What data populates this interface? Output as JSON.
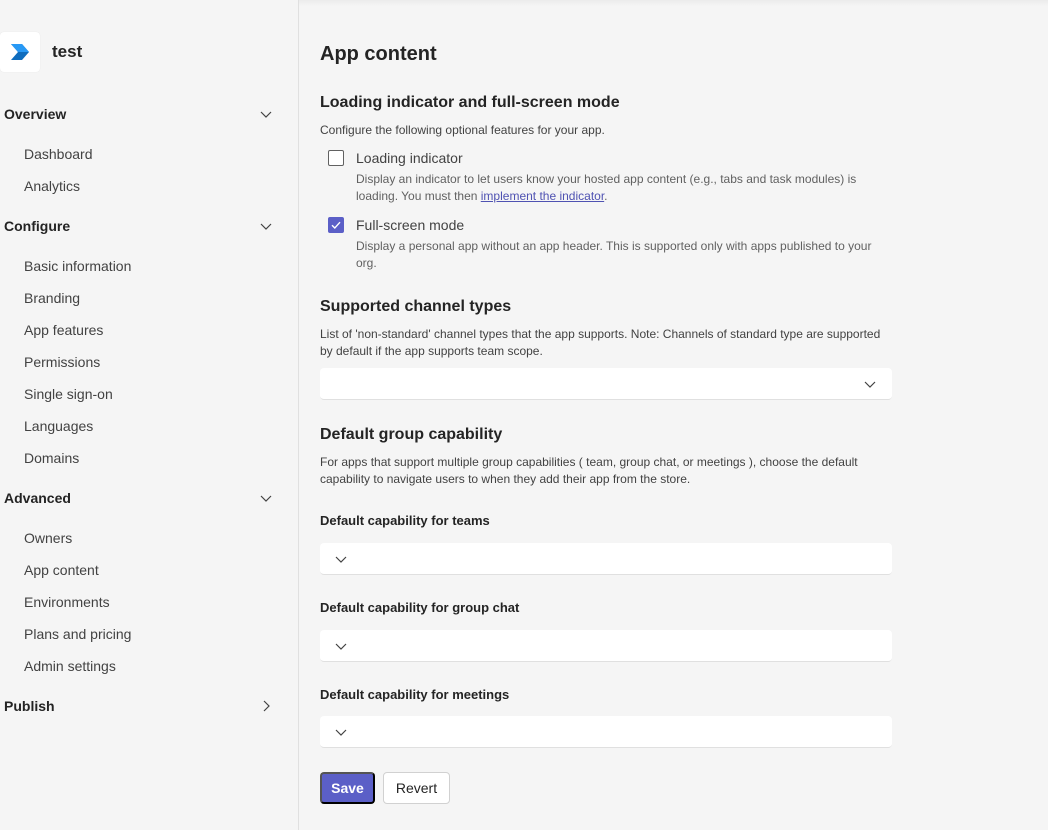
{
  "app": {
    "name": "test"
  },
  "sidebar": {
    "groups": [
      {
        "label": "Overview",
        "items": [
          "Dashboard",
          "Analytics"
        ]
      },
      {
        "label": "Configure",
        "items": [
          "Basic information",
          "Branding",
          "App features",
          "Permissions",
          "Single sign-on",
          "Languages",
          "Domains"
        ]
      },
      {
        "label": "Advanced",
        "items": [
          "Owners",
          "App content",
          "Environments",
          "Plans and pricing",
          "Admin settings"
        ]
      },
      {
        "label": "Publish",
        "items": []
      }
    ]
  },
  "main": {
    "title": "App content",
    "loading_section": {
      "title": "Loading indicator and full-screen mode",
      "description": "Configure the following optional features for your app.",
      "loading_indicator": {
        "label": "Loading indicator",
        "checked": false,
        "desc_prefix": "Display an indicator to let users know your hosted app content (e.g., tabs and task modules) is loading. You must then ",
        "link_text": "implement the indicator",
        "desc_suffix": "."
      },
      "full_screen": {
        "label": "Full-screen mode",
        "checked": true,
        "description": "Display a personal app without an app header. This is supported only with apps published to your org."
      }
    },
    "channel_section": {
      "title": "Supported channel types",
      "description": "List of 'non-standard' channel types that the app supports. Note: Channels of standard type are supported by default if the app supports team scope.",
      "dropdown_value": ""
    },
    "group_section": {
      "title": "Default group capability",
      "description": "For apps that support multiple group capabilities ( team, group chat, or meetings ), choose the default capability to navigate users to when they add their app from the store.",
      "teams_label": "Default capability for teams",
      "groupchat_label": "Default capability for group chat",
      "meetings_label": "Default capability for meetings"
    },
    "buttons": {
      "save": "Save",
      "revert": "Revert"
    }
  },
  "colors": {
    "accent": "#5b5fc7",
    "link": "#4f52b2",
    "background": "#f5f5f5"
  }
}
